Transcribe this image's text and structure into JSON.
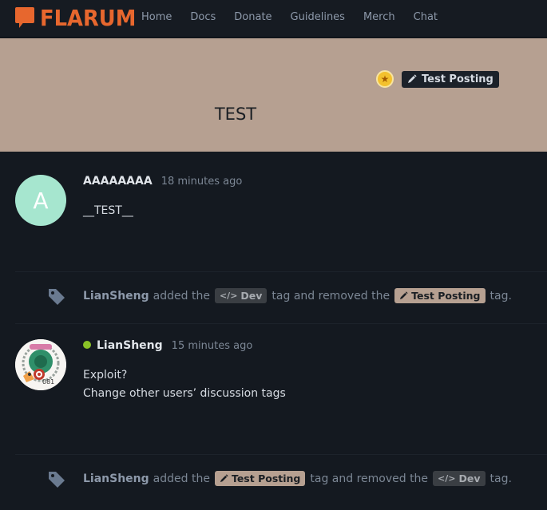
{
  "header": {
    "logo_text": "FLARUM",
    "nav": [
      "Home",
      "Docs",
      "Donate",
      "Guidelines",
      "Merch",
      "Chat"
    ]
  },
  "hero": {
    "tag_label": "Test Posting",
    "title": "TEST",
    "background_color": "#b6a091"
  },
  "posts": [
    {
      "avatar_letter": "A",
      "avatar_color": "#a6e6cf",
      "username": "AAAAAAAA",
      "time": "18 minutes ago",
      "lines": [
        "__TEST__"
      ]
    },
    {
      "username": "LianSheng",
      "online": true,
      "time": "15 minutes ago",
      "lines": [
        "Exploit?",
        "Change other users’ discussion tags"
      ]
    }
  ],
  "events": [
    {
      "user": "LianSheng",
      "w1": "added the",
      "tag1": "Dev",
      "w2": "tag and removed the",
      "tag2": "Test Posting",
      "w3": "tag."
    },
    {
      "user": "LianSheng",
      "w1": "added the",
      "tag1": "Test Posting",
      "w2": "tag and removed the",
      "tag2": "Dev",
      "w3": "tag."
    }
  ],
  "icons": {
    "dev_tag_icon": "code-icon",
    "test_tag_icon": "pencil-icon",
    "event_icon": "tag-icon",
    "hero_badge_icon": "star-icon"
  },
  "colors": {
    "accent": "#e7672e",
    "online": "#8ac227"
  }
}
